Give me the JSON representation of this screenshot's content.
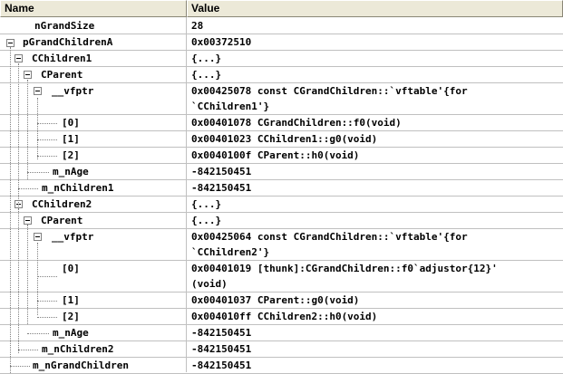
{
  "columns": {
    "name": "Name",
    "value": "Value"
  },
  "rows": [
    {
      "name": "nGrandSize",
      "value": "28"
    },
    {
      "name": "pGrandChildrenA",
      "value": "0x00372510"
    },
    {
      "name": "CChildren1",
      "value": "{...}"
    },
    {
      "name": "CParent",
      "value": "{...}"
    },
    {
      "name": "__vfptr",
      "value": "0x00425078 const CGrandChildren::`vftable'{for",
      "value2": "`CChildren1'}"
    },
    {
      "name": "[0]",
      "value": "0x00401078 CGrandChildren::f0(void)"
    },
    {
      "name": "[1]",
      "value": "0x00401023 CChildren1::g0(void)"
    },
    {
      "name": "[2]",
      "value": "0x0040100f CParent::h0(void)"
    },
    {
      "name": "m_nAge",
      "value": "-842150451"
    },
    {
      "name": "m_nChildren1",
      "value": "-842150451"
    },
    {
      "name": "CChildren2",
      "value": "{...}"
    },
    {
      "name": "CParent",
      "value": "{...}"
    },
    {
      "name": "__vfptr",
      "value": "0x00425064 const CGrandChildren::`vftable'{for",
      "value2": "`CChildren2'}"
    },
    {
      "name": "[0]",
      "value": "0x00401019 [thunk]:CGrandChildren::f0`adjustor{12}'",
      "value2": "(void)"
    },
    {
      "name": "[1]",
      "value": "0x00401037 CParent::g0(void)"
    },
    {
      "name": "[2]",
      "value": "0x004010ff CChildren2::h0(void)"
    },
    {
      "name": "m_nAge",
      "value": "-842150451"
    },
    {
      "name": "m_nChildren2",
      "value": "-842150451"
    },
    {
      "name": "m_nGrandChildren",
      "value": "-842150451"
    }
  ]
}
